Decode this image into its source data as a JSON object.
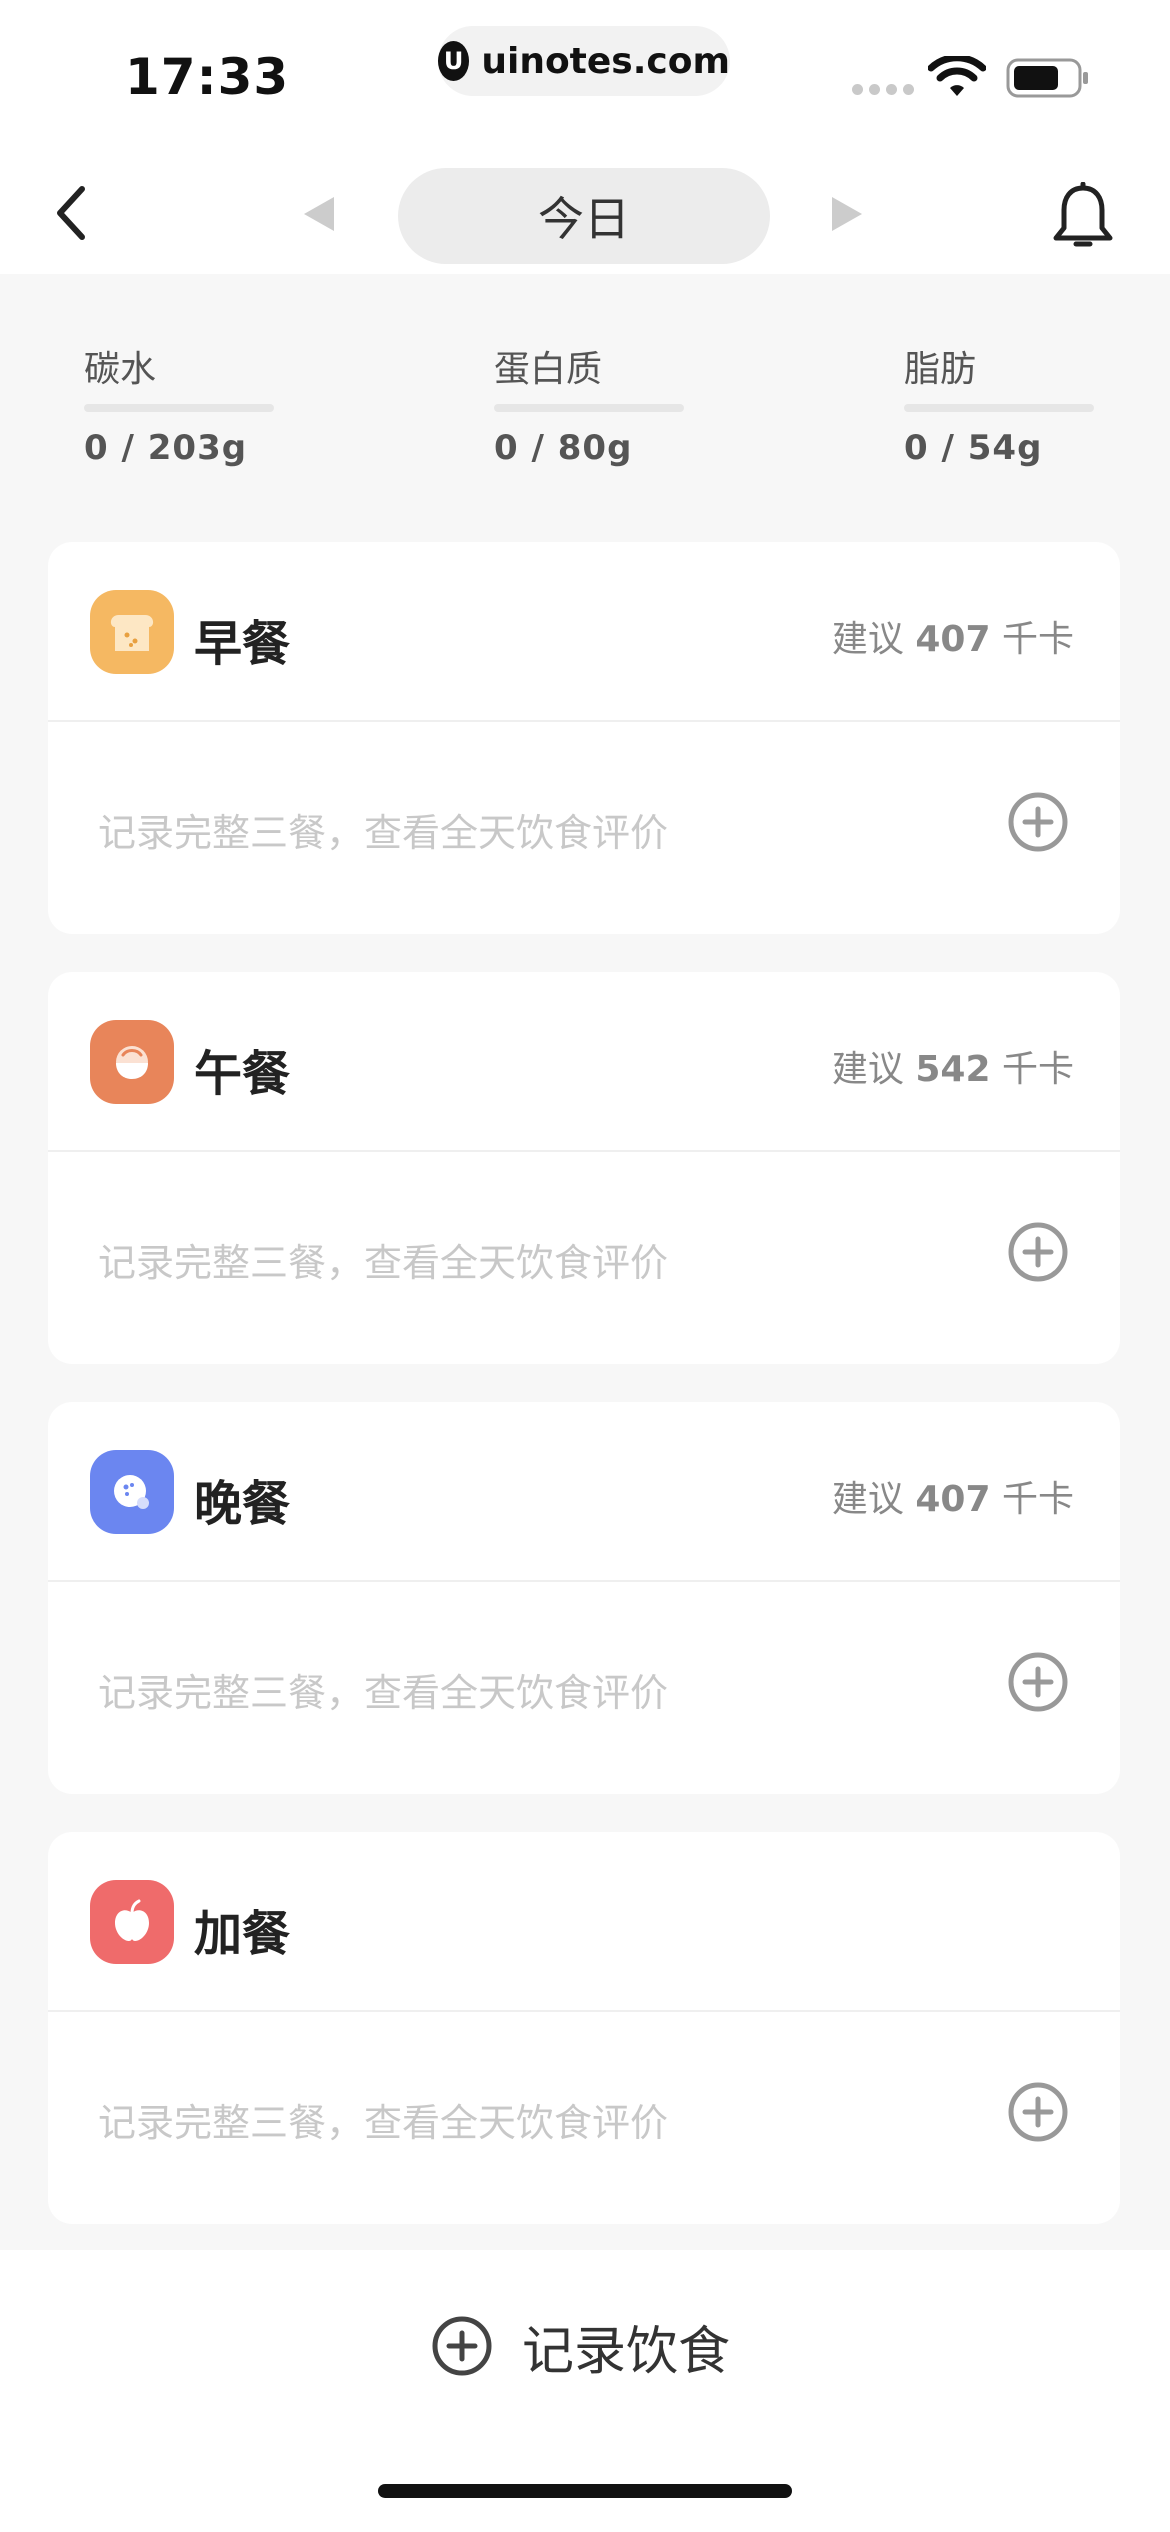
{
  "status": {
    "time": "17:33",
    "url": "uinotes.com"
  },
  "nav": {
    "date_label": "今日"
  },
  "macros": [
    {
      "label": "碳水",
      "value": "0 / 203g"
    },
    {
      "label": "蛋白质",
      "value": "0 / 80g"
    },
    {
      "label": "脂肪",
      "value": "0 / 54g"
    }
  ],
  "meals": [
    {
      "title": "早餐",
      "suggest_prefix": "建议",
      "kcal": "407",
      "unit": "千卡",
      "hint": "记录完整三餐，查看全天饮食评价",
      "color": "#f5b862"
    },
    {
      "title": "午餐",
      "suggest_prefix": "建议",
      "kcal": "542",
      "unit": "千卡",
      "hint": "记录完整三餐，查看全天饮食评价",
      "color": "#e8855a"
    },
    {
      "title": "晚餐",
      "suggest_prefix": "建议",
      "kcal": "407",
      "unit": "千卡",
      "hint": "记录完整三餐，查看全天饮食评价",
      "color": "#6b86f0"
    },
    {
      "title": "加餐",
      "hint": "记录完整三餐，查看全天饮食评价",
      "color": "#ef6b6b"
    }
  ],
  "bottom": {
    "record_label": "记录饮食"
  },
  "icons": {
    "breakfast": "bread-icon",
    "lunch": "rice-bowl-icon",
    "dinner": "dinner-plate-icon",
    "snack": "apple-icon"
  }
}
